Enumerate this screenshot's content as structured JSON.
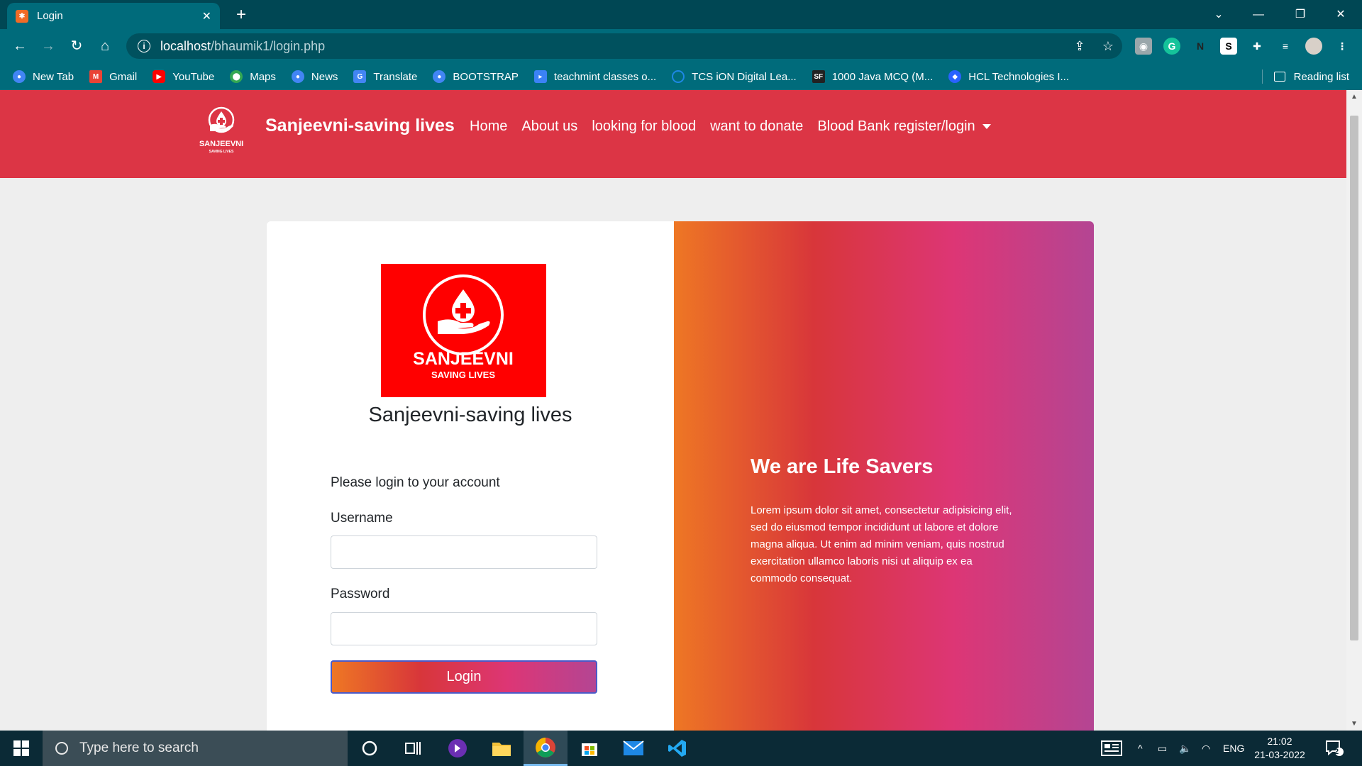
{
  "browser": {
    "tab_title": "Login",
    "tab_favicon": "xampp-icon",
    "url_host": "localhost",
    "url_path": "/bhaumik1/login.php",
    "bookmarks": [
      {
        "label": "New Tab",
        "icon": "globe-icon",
        "color": "#4285f4"
      },
      {
        "label": "Gmail",
        "icon": "gmail-icon",
        "color": "#ea4335"
      },
      {
        "label": "YouTube",
        "icon": "youtube-icon",
        "color": "#ff0000"
      },
      {
        "label": "Maps",
        "icon": "maps-icon",
        "color": "#34a853"
      },
      {
        "label": "News",
        "icon": "globe-icon",
        "color": "#4285f4"
      },
      {
        "label": "Translate",
        "icon": "translate-icon",
        "color": "#4285f4"
      },
      {
        "label": "BOOTSTRAP",
        "icon": "globe-icon",
        "color": "#4285f4"
      },
      {
        "label": "teachmint classes o...",
        "icon": "teachmint-icon",
        "color": "#3b82f6"
      },
      {
        "label": "TCS iON Digital Lea...",
        "icon": "tcs-icon",
        "color": "#1e88e5"
      },
      {
        "label": "1000 Java MCQ (M...",
        "icon": "sanfoundry-icon",
        "color": "#222222"
      },
      {
        "label": "HCL Technologies I...",
        "icon": "hcl-icon",
        "color": "#2962ff"
      }
    ],
    "reading_list": "Reading list"
  },
  "site": {
    "brand": "Sanjeevni-saving lives",
    "logo_text": "SANJEEVNI",
    "logo_subtext": "SAVING LIVES",
    "nav": [
      "Home",
      "About us",
      "looking for blood",
      "want to donate",
      "Blood Bank register/login"
    ]
  },
  "login": {
    "logo_text": "SANJEEVNI",
    "logo_subtext": "SAVING LIVES",
    "title": "Sanjeevni-saving lives",
    "prompt": "Please login to your account",
    "username_label": "Username",
    "username_value": "",
    "password_label": "Password",
    "password_value": "",
    "button": "Login"
  },
  "promo": {
    "heading": "We are Life Savers",
    "body": "Lorem ipsum dolor sit amet, consectetur adipisicing elit, sed do eiusmod tempor incididunt ut labore et dolore magna aliqua. Ut enim ad minim veniam, quis nostrud exercitation ullamco laboris nisi ut aliquip ex ea commodo consequat."
  },
  "taskbar": {
    "search_placeholder": "Type here to search",
    "language": "ENG",
    "time": "21:02",
    "date": "21-03-2022",
    "notification_count": "2"
  },
  "colors": {
    "navbar": "#dc3545",
    "gradient": [
      "#ee7724",
      "#d8363a",
      "#dd3675",
      "#b44593"
    ],
    "logo_red": "#ff0000"
  }
}
